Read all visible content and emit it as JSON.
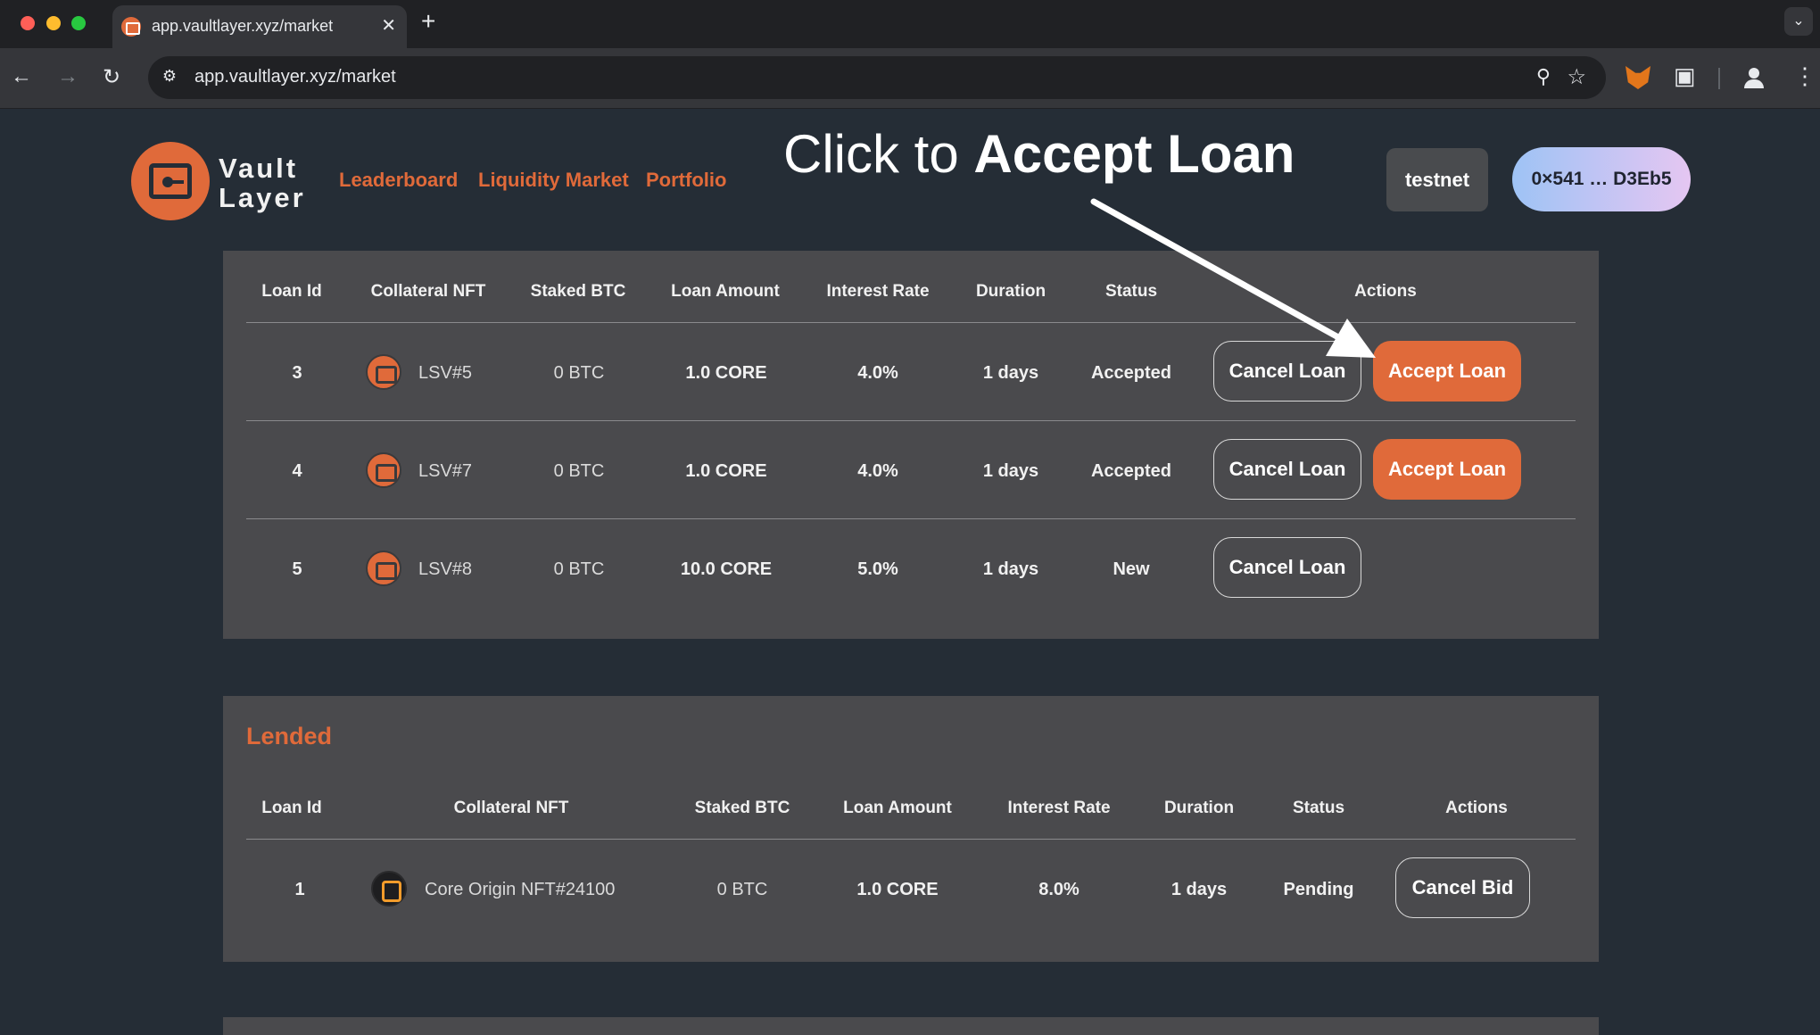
{
  "browser": {
    "tab_title": "app.vaultlayer.xyz/market",
    "tab_close": "✕",
    "new_tab": "+",
    "tab_menu": "⌄",
    "url": "app.vaultlayer.xyz/market"
  },
  "header": {
    "logo_line1": "Vault",
    "logo_line2": "Layer",
    "nav": [
      "Leaderboard",
      "Liquidity Market",
      "Portfolio"
    ],
    "network": "testnet",
    "wallet": "0×541 … D3Eb5"
  },
  "annotation": {
    "prefix": "Click to ",
    "emphasis": "Accept Loan"
  },
  "loans_table": {
    "headers": [
      "Loan Id",
      "Collateral NFT",
      "Staked BTC",
      "Loan Amount",
      "Interest Rate",
      "Duration",
      "Status",
      "Actions"
    ],
    "rows": [
      {
        "id": "3",
        "nft": "LSV#5",
        "staked": "0 BTC",
        "amount": "1.0 CORE",
        "rate": "4.0%",
        "duration": "1 days",
        "status": "Accepted",
        "cancel": "Cancel Loan",
        "accept": "Accept Loan"
      },
      {
        "id": "4",
        "nft": "LSV#7",
        "staked": "0 BTC",
        "amount": "1.0 CORE",
        "rate": "4.0%",
        "duration": "1 days",
        "status": "Accepted",
        "cancel": "Cancel Loan",
        "accept": "Accept Loan"
      },
      {
        "id": "5",
        "nft": "LSV#8",
        "staked": "0 BTC",
        "amount": "10.0 CORE",
        "rate": "5.0%",
        "duration": "1 days",
        "status": "New",
        "cancel": "Cancel Loan"
      }
    ]
  },
  "lended": {
    "title": "Lended",
    "headers": [
      "Loan Id",
      "Collateral NFT",
      "Staked BTC",
      "Loan Amount",
      "Interest Rate",
      "Duration",
      "Status",
      "Actions"
    ],
    "rows": [
      {
        "id": "1",
        "nft": "Core Origin NFT#24100",
        "staked": "0 BTC",
        "amount": "1.0 CORE",
        "rate": "8.0%",
        "duration": "1 days",
        "status": "Pending",
        "cancel": "Cancel Bid"
      }
    ]
  },
  "colors": {
    "accent": "#e06a3a",
    "page_bg": "#252d36",
    "panel_bg": "#4a4a4d"
  }
}
